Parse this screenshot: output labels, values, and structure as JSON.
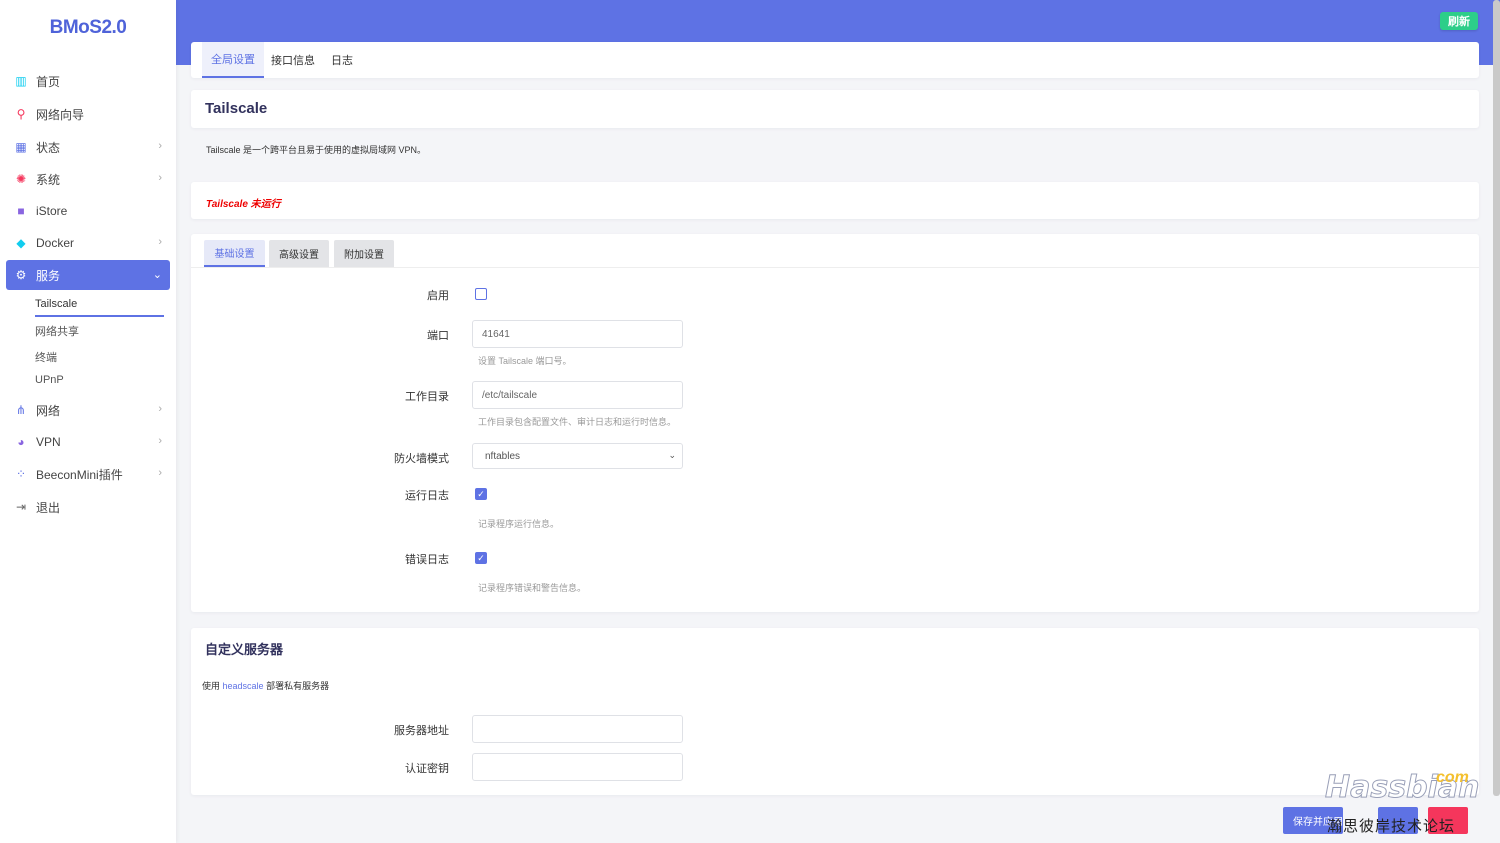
{
  "brand": "BMoS2.0",
  "sidebar": {
    "items": [
      {
        "label": "首页",
        "icon": "dashboard-icon"
      },
      {
        "label": "网络向导",
        "icon": "map-pin-icon"
      },
      {
        "label": "状态",
        "icon": "grid-icon"
      },
      {
        "label": "系统",
        "icon": "gear-icon"
      },
      {
        "label": "iStore",
        "icon": "store-icon"
      },
      {
        "label": "Docker",
        "icon": "docker-icon"
      },
      {
        "label": "服务",
        "icon": "services-icon"
      },
      {
        "label": "网络",
        "icon": "network-icon"
      },
      {
        "label": "VPN",
        "icon": "globe-icon"
      },
      {
        "label": "BeeconMini插件",
        "icon": "plugin-icon"
      },
      {
        "label": "退出",
        "icon": "logout-icon"
      }
    ],
    "sub_items": [
      "Tailscale",
      "网络共享",
      "终端",
      "UPnP"
    ]
  },
  "header": {
    "refresh_label": "刷新"
  },
  "top_tabs": [
    "全局设置",
    "接口信息",
    "日志"
  ],
  "page": {
    "title": "Tailscale",
    "description": "Tailscale 是一个跨平台且易于使用的虚拟局域网 VPN。",
    "status": "Tailscale 未运行"
  },
  "settings_tabs": [
    "基础设置",
    "高级设置",
    "附加设置"
  ],
  "form": {
    "enable_label": "启用",
    "port_label": "端口",
    "port_value": "41641",
    "port_help": "设置 Tailscale 端口号。",
    "workdir_label": "工作目录",
    "workdir_value": "/etc/tailscale",
    "workdir_help": "工作目录包含配置文件、审计日志和运行时信息。",
    "firewall_label": "防火墙模式",
    "firewall_value": "nftables",
    "runlog_label": "运行日志",
    "runlog_help": "记录程序运行信息。",
    "errlog_label": "错误日志",
    "errlog_help": "记录程序错误和警告信息。"
  },
  "custom_server": {
    "title": "自定义服务器",
    "desc_prefix": "使用",
    "desc_link": "headscale",
    "desc_suffix": "部署私有服务器",
    "server_label": "服务器地址",
    "auth_label": "认证密钥"
  },
  "footer": {
    "save_label": "保存并应用",
    "watermark": "Hassbian",
    "watermark_com": "com",
    "watermark_cn": "瀚思彼岸技术论坛"
  },
  "colors": {
    "accent": "#5e72e4",
    "success": "#2dce89",
    "danger": "#f5365c",
    "status_error": "#ee0000"
  }
}
